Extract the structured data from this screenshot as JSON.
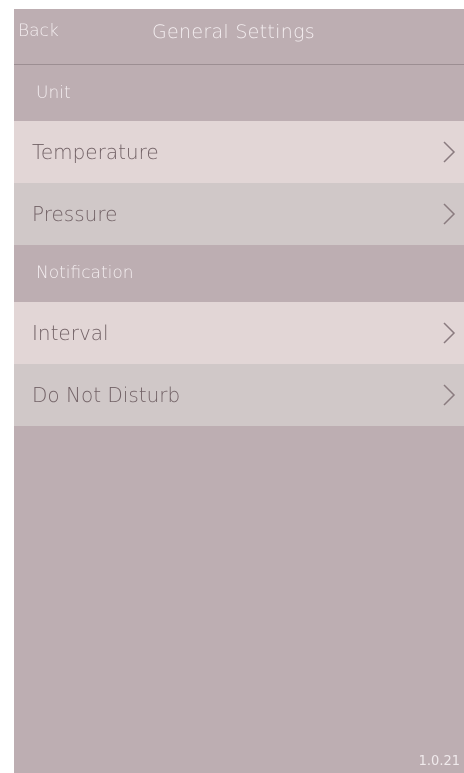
{
  "navbar": {
    "back_label": "Back",
    "title": "General Settings"
  },
  "sections": [
    {
      "header": "Unit",
      "items": [
        {
          "label": "Temperature"
        },
        {
          "label": "Pressure"
        }
      ]
    },
    {
      "header": "Notification",
      "items": [
        {
          "label": "Interval"
        },
        {
          "label": "Do Not Disturb"
        }
      ]
    }
  ],
  "footer": {
    "version": "1.0.21"
  },
  "colors": {
    "background": "#bdaeb2",
    "row_light": "#e2d6d6",
    "row_dark": "#d0c8c8",
    "text_light": "#f4eef0",
    "text_dark": "#726266"
  },
  "icons": {
    "row_disclosure": "chevron-right-icon"
  }
}
